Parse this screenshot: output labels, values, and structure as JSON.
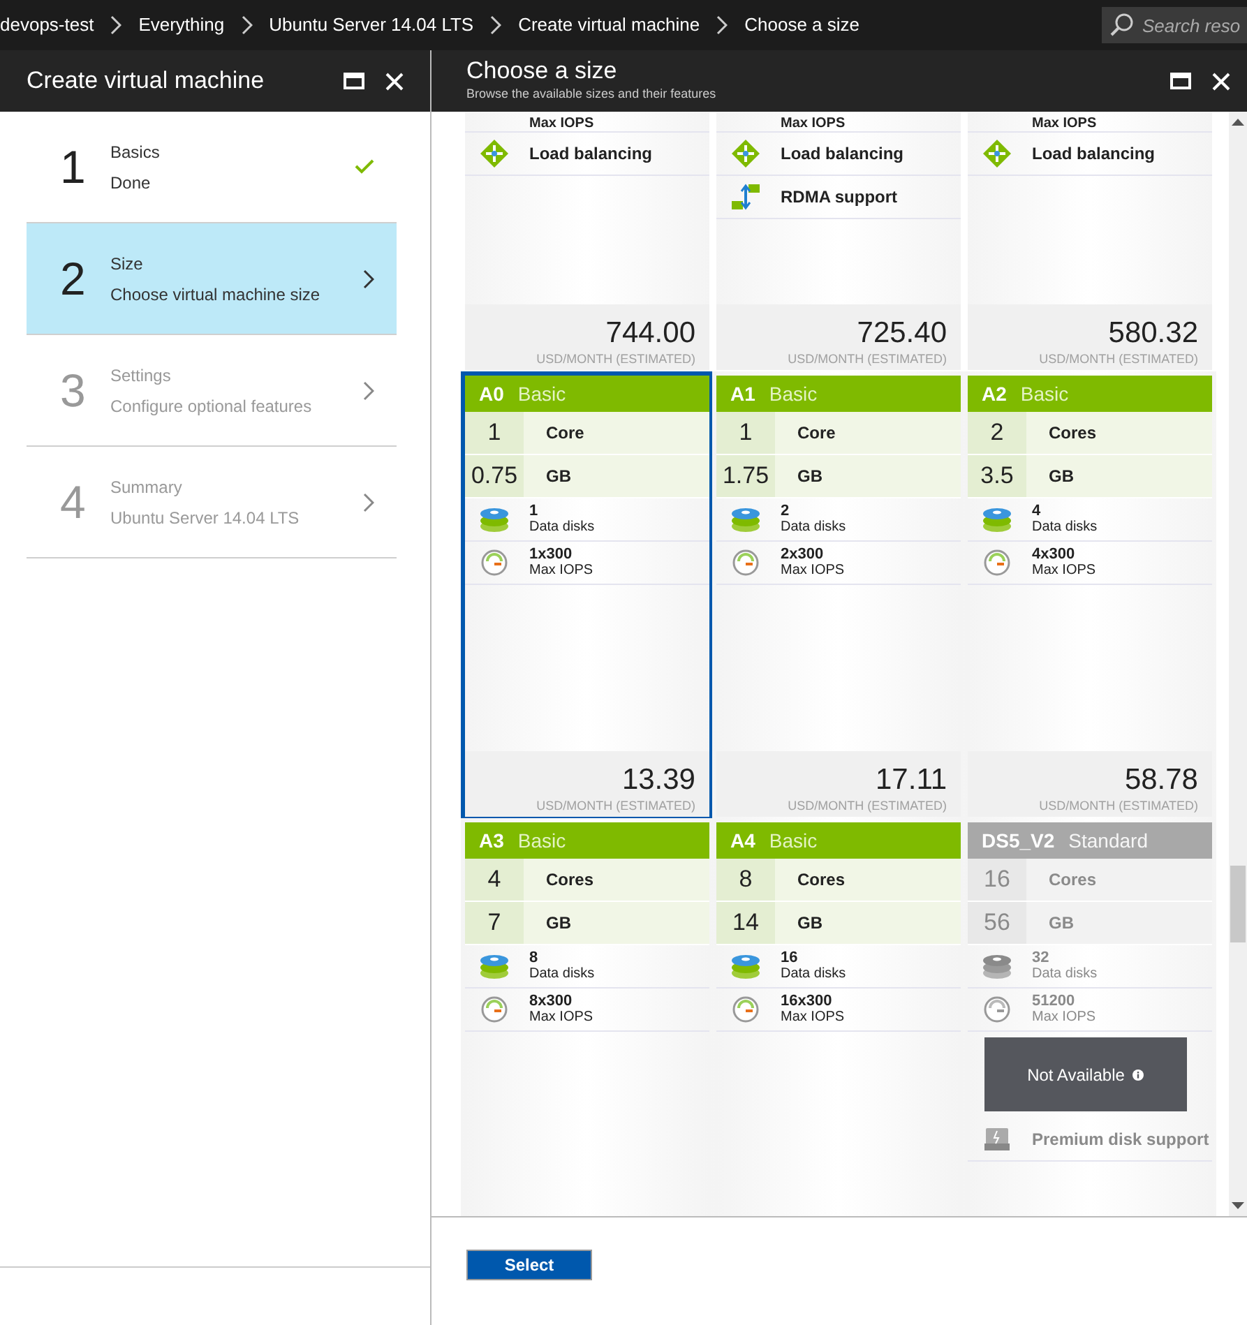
{
  "breadcrumbs": [
    "devops-test",
    "Everything",
    "Ubuntu Server 14.04 LTS",
    "Create virtual machine",
    "Choose a size"
  ],
  "search": {
    "placeholder": "Search reso"
  },
  "left_blade": {
    "title": "Create virtual machine",
    "steps": [
      {
        "number": "1",
        "title": "Basics",
        "subtitle": "Done",
        "done": true,
        "disabled": false,
        "selected": false
      },
      {
        "number": "2",
        "title": "Size",
        "subtitle": "Choose virtual machine size",
        "done": false,
        "disabled": false,
        "selected": true
      },
      {
        "number": "3",
        "title": "Settings",
        "subtitle": "Configure optional features",
        "done": false,
        "disabled": true,
        "selected": false
      },
      {
        "number": "4",
        "title": "Summary",
        "subtitle": "Ubuntu Server 14.04 LTS",
        "done": false,
        "disabled": true,
        "selected": false
      }
    ]
  },
  "right_blade": {
    "title": "Choose a size",
    "subtitle": "Browse the available sizes and their features",
    "cards_above": [
      {
        "cut_label": "Max IOPS",
        "features": [
          {
            "kind": "load-balancing",
            "value": "Load balancing"
          }
        ],
        "price": "744.00",
        "price_unit": "USD/MONTH (ESTIMATED)"
      },
      {
        "cut_label": "Max IOPS",
        "features": [
          {
            "kind": "load-balancing",
            "value": "Load balancing"
          },
          {
            "kind": "rdma",
            "value": "RDMA support"
          }
        ],
        "price": "725.40",
        "price_unit": "USD/MONTH (ESTIMATED)"
      },
      {
        "cut_label": "Max IOPS",
        "features": [
          {
            "kind": "load-balancing",
            "value": "Load balancing"
          }
        ],
        "price": "580.32",
        "price_unit": "USD/MONTH (ESTIMATED)"
      }
    ],
    "cards": [
      {
        "name": "A0",
        "tier": "Basic",
        "available": true,
        "selected": true,
        "specs": [
          {
            "value": "1",
            "label": "Core"
          },
          {
            "value": "0.75",
            "label": "GB"
          }
        ],
        "features": [
          {
            "kind": "disks",
            "value": "1",
            "label": "Data disks"
          },
          {
            "kind": "iops",
            "value": "1x300",
            "label": "Max IOPS"
          }
        ],
        "price": "13.39",
        "price_unit": "USD/MONTH (ESTIMATED)"
      },
      {
        "name": "A1",
        "tier": "Basic",
        "available": true,
        "selected": false,
        "specs": [
          {
            "value": "1",
            "label": "Core"
          },
          {
            "value": "1.75",
            "label": "GB"
          }
        ],
        "features": [
          {
            "kind": "disks",
            "value": "2",
            "label": "Data disks"
          },
          {
            "kind": "iops",
            "value": "2x300",
            "label": "Max IOPS"
          }
        ],
        "price": "17.11",
        "price_unit": "USD/MONTH (ESTIMATED)"
      },
      {
        "name": "A2",
        "tier": "Basic",
        "available": true,
        "selected": false,
        "specs": [
          {
            "value": "2",
            "label": "Cores"
          },
          {
            "value": "3.5",
            "label": "GB"
          }
        ],
        "features": [
          {
            "kind": "disks",
            "value": "4",
            "label": "Data disks"
          },
          {
            "kind": "iops",
            "value": "4x300",
            "label": "Max IOPS"
          }
        ],
        "price": "58.78",
        "price_unit": "USD/MONTH (ESTIMATED)"
      },
      {
        "name": "A3",
        "tier": "Basic",
        "available": true,
        "selected": false,
        "specs": [
          {
            "value": "4",
            "label": "Cores"
          },
          {
            "value": "7",
            "label": "GB"
          }
        ],
        "features": [
          {
            "kind": "disks",
            "value": "8",
            "label": "Data disks"
          },
          {
            "kind": "iops",
            "value": "8x300",
            "label": "Max IOPS"
          }
        ]
      },
      {
        "name": "A4",
        "tier": "Basic",
        "available": true,
        "selected": false,
        "specs": [
          {
            "value": "8",
            "label": "Cores"
          },
          {
            "value": "14",
            "label": "GB"
          }
        ],
        "features": [
          {
            "kind": "disks",
            "value": "16",
            "label": "Data disks"
          },
          {
            "kind": "iops",
            "value": "16x300",
            "label": "Max IOPS"
          }
        ]
      },
      {
        "name": "DS5_V2",
        "tier": "Standard",
        "available": false,
        "selected": false,
        "specs": [
          {
            "value": "16",
            "label": "Cores"
          },
          {
            "value": "56",
            "label": "GB"
          }
        ],
        "features": [
          {
            "kind": "disks",
            "value": "32",
            "label": "Data disks"
          },
          {
            "kind": "iops",
            "value": "51200",
            "label": "Max IOPS"
          },
          {
            "kind": "covered"
          },
          {
            "kind": "premium-disk",
            "value": "Premium disk support"
          }
        ],
        "overlay": "Not Available"
      }
    ],
    "select_button": "Select"
  }
}
